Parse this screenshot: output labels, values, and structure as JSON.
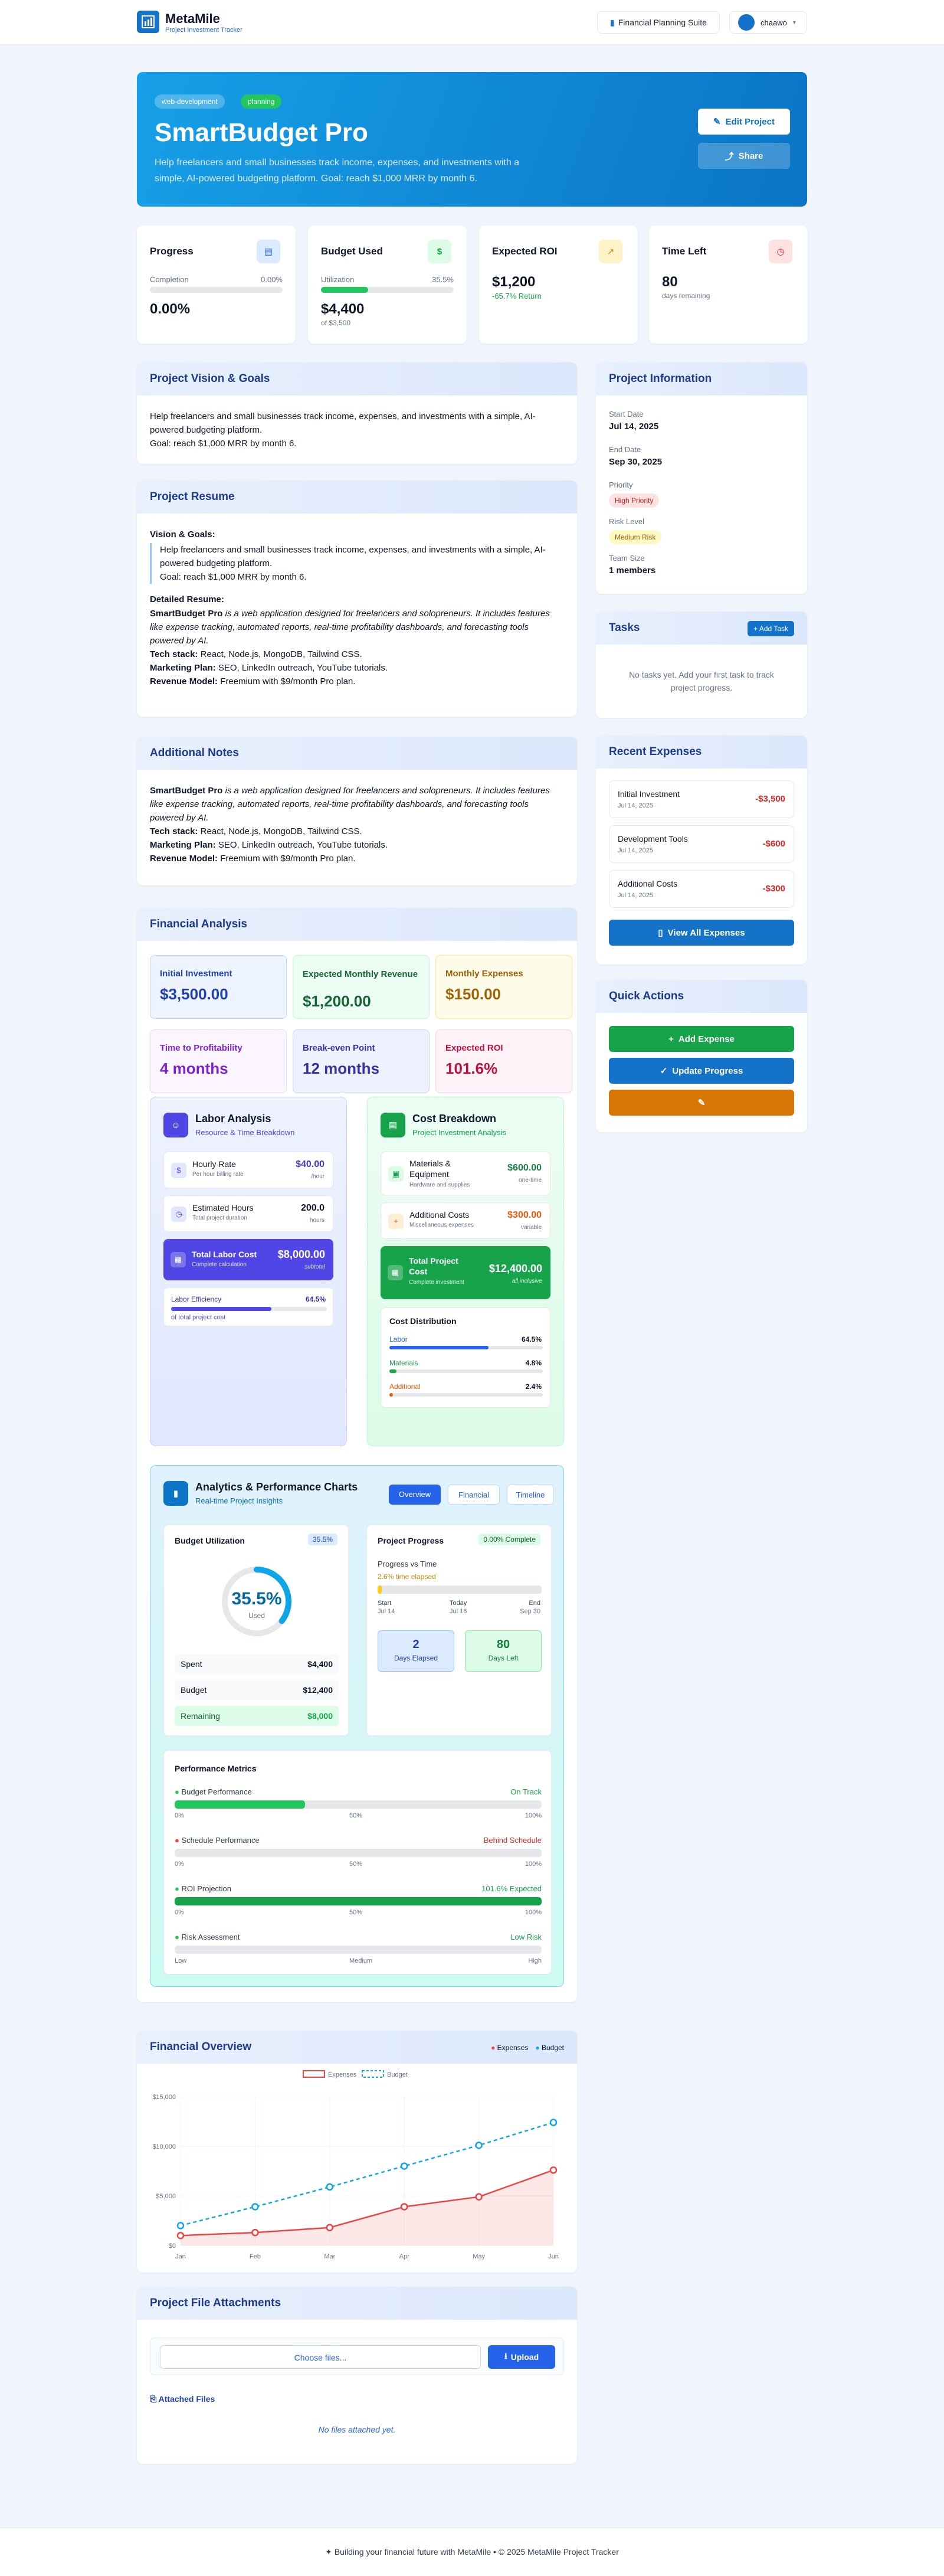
{
  "header": {
    "brand": "MetaMile",
    "subtitle": "Project Investment Tracker",
    "suite_label": "Financial Planning Suite",
    "user_name": "chaawo"
  },
  "hero": {
    "tags": [
      "web-development",
      "planning"
    ],
    "title": "SmartBudget Pro",
    "description": "Help freelancers and small businesses track income, expenses, and investments with a simple, AI-powered budgeting platform. Goal: reach $1,000 MRR by month 6.",
    "edit_label": "Edit Project",
    "share_label": "Share"
  },
  "stats": {
    "progress": {
      "title": "Progress",
      "label": "Completion",
      "pct": "0.00%",
      "value": "0.00%",
      "fill": 0
    },
    "budget": {
      "title": "Budget Used",
      "label": "Utilization",
      "pct": "35.5%",
      "value": "$4,400",
      "sub": "of $3,500",
      "fill": 0.355,
      "icon": "$"
    },
    "roi": {
      "title": "Expected ROI",
      "value": "$1,200",
      "sub": "-65.7% Return"
    },
    "time": {
      "title": "Time Left",
      "value": "80",
      "sub": "days remaining"
    }
  },
  "vision": {
    "title": "Project Vision & Goals",
    "line1": "Help freelancers and small businesses track income, expenses, and investments with a simple, AI-powered budgeting platform.",
    "line2": "Goal: reach $1,000 MRR by month 6."
  },
  "resume": {
    "title": "Project Resume",
    "vg_label": "Vision & Goals:",
    "vg_text": "Help freelancers and small businesses track income, expenses, and investments with a simple, AI-powered budgeting platform.",
    "vg_goal": "Goal: reach $1,000 MRR by month 6.",
    "detailed_label": "Detailed Resume:",
    "name": "SmartBudget Pro",
    "desc": " is a web application designed for freelancers and solopreneurs. It includes features like expense tracking, automated reports, real-time profitability dashboards, and forecasting tools powered by AI.",
    "tech_label": "Tech stack:",
    "tech": " React, Node.js, MongoDB, Tailwind CSS.",
    "mkt_label": "Marketing Plan:",
    "mkt": " SEO, LinkedIn outreach, YouTube tutorials.",
    "rev_label": "Revenue Model:",
    "rev": " Freemium with $9/month Pro plan."
  },
  "notes": {
    "title": "Additional Notes"
  },
  "info": {
    "title": "Project Information",
    "start_label": "Start Date",
    "start": "Jul 14, 2025",
    "end_label": "End Date",
    "end": "Sep 30, 2025",
    "priority_label": "Priority",
    "priority": "High Priority",
    "risk_label": "Risk Level",
    "risk": "Medium Risk",
    "team_label": "Team Size",
    "team": "1 members"
  },
  "tasks": {
    "title": "Tasks",
    "add_label": "+ Add Task",
    "empty": "No tasks yet. Add your first task to track project progress."
  },
  "expenses": {
    "title": "Recent Expenses",
    "items": [
      {
        "name": "Initial Investment",
        "date": "Jul 14, 2025",
        "amount": "-$3,500"
      },
      {
        "name": "Development Tools",
        "date": "Jul 14, 2025",
        "amount": "-$600"
      },
      {
        "name": "Additional Costs",
        "date": "Jul 14, 2025",
        "amount": "-$300"
      }
    ],
    "view_all": "View All Expenses"
  },
  "actions": {
    "title": "Quick Actions",
    "add_expense": "Add Expense",
    "update_progress": "Update Progress"
  },
  "financial": {
    "title": "Financial Analysis",
    "cards": [
      {
        "label": "Initial Investment",
        "value": "$3,500.00"
      },
      {
        "label": "Expected Monthly Revenue",
        "value": "$1,200.00"
      },
      {
        "label": "Monthly Expenses",
        "value": "$150.00"
      },
      {
        "label": "Time to Profitability",
        "value": "4 months"
      },
      {
        "label": "Break-even Point",
        "value": "12 months"
      },
      {
        "label": "Expected ROI",
        "value": "101.6%"
      }
    ]
  },
  "labor": {
    "title": "Labor Analysis",
    "subtitle": "Resource & Time Breakdown",
    "rate_label": "Hourly Rate",
    "rate_sub": "Per hour billing rate",
    "rate": "$40.00",
    "rate_unit": "/hour",
    "hours_label": "Estimated Hours",
    "hours_sub": "Total project duration",
    "hours": "200.0",
    "hours_unit": "hours",
    "total_label": "Total Labor Cost",
    "total_sub": "Complete calculation",
    "total": "$8,000.00",
    "total_unit": "subtotal",
    "eff_label": "Labor Efficiency",
    "eff": "64.5%",
    "eff_sub": "of total project cost",
    "eff_fill": 0.645
  },
  "cost": {
    "title": "Cost Breakdown",
    "subtitle": "Project Investment Analysis",
    "mat_label": "Materials & Equipment",
    "mat_sub": "Hardware and supplies",
    "mat": "$600.00",
    "mat_unit": "one-time",
    "add_label": "Additional Costs",
    "add_sub": "Miscellaneous expenses",
    "add": "$300.00",
    "add_unit": "variable",
    "total_label": "Total Project Cost",
    "total_sub": "Complete investment",
    "total": "$12,400.00",
    "total_unit": "all inclusive",
    "dist_title": "Cost Distribution",
    "dist": [
      {
        "label": "Labor",
        "pct": "64.5%",
        "fill": 0.645,
        "color": "#2563eb"
      },
      {
        "label": "Materials",
        "pct": "4.8%",
        "fill": 0.048,
        "color": "#16a34a"
      },
      {
        "label": "Additional",
        "pct": "2.4%",
        "fill": 0.024,
        "color": "#ea580c"
      }
    ]
  },
  "analytics": {
    "title": "Analytics & Performance Charts",
    "subtitle": "Real-time Project Insights",
    "tabs": [
      "Overview",
      "Financial",
      "Timeline"
    ],
    "bu_title": "Budget Utilization",
    "bu_pct": "35.5%",
    "bu_center": "35.5%",
    "bu_used": "Used",
    "bu_fill": 0.355,
    "spent_label": "Spent",
    "spent": "$4,400",
    "budget_label": "Budget",
    "budget": "$12,400",
    "remaining_label": "Remaining",
    "remaining": "$8,000",
    "pp_title": "Project Progress",
    "pp_badge": "0.00% Complete",
    "pvt": "Progress vs Time",
    "elapsed_text": "2.6% time elapsed",
    "time_fill": 0.026,
    "start": "Start",
    "start_date": "Jul 14",
    "today": "Today",
    "today_date": "Jul 16",
    "end": "End",
    "end_date": "Sep 30",
    "days_elapsed": "2",
    "days_elapsed_label": "Days Elapsed",
    "days_left": "80",
    "days_left_label": "Days Left",
    "pm_title": "Performance Metrics",
    "metrics": [
      {
        "label": "Budget Performance",
        "status": "On Track",
        "fill": 0.355,
        "dot": "#22c55e",
        "scolor": "#16a34a",
        "bar": "#22c55e",
        "ticks": [
          "0%",
          "50%",
          "100%"
        ]
      },
      {
        "label": "Schedule Performance",
        "status": "Behind Schedule",
        "fill": 0,
        "dot": "#ef4444",
        "scolor": "#dc2626",
        "bar": "#ef4444",
        "ticks": [
          "0%",
          "50%",
          "100%"
        ]
      },
      {
        "label": "ROI Projection",
        "status": "101.6% Expected",
        "fill": 1,
        "dot": "#22c55e",
        "scolor": "#16a34a",
        "bar": "#16a34a",
        "ticks": [
          "0%",
          "50%",
          "100%"
        ]
      },
      {
        "label": "Risk Assessment",
        "status": "Low Risk",
        "fill": 0,
        "dot": "#22c55e",
        "scolor": "#16a34a",
        "bar": "#22c55e",
        "ticks": [
          "Low",
          "Medium",
          "High"
        ]
      }
    ]
  },
  "overview": {
    "title": "Financial Overview",
    "legend_expenses": "Expenses",
    "legend_budget": "Budget"
  },
  "chart_data": {
    "type": "line",
    "categories": [
      "Jan",
      "Feb",
      "Mar",
      "Apr",
      "May",
      "Jun"
    ],
    "series": [
      {
        "name": "Expenses",
        "values": [
          1000,
          1300,
          1800,
          3900,
          4900,
          7600
        ],
        "color": "#ef4444"
      },
      {
        "name": "Budget",
        "values": [
          2000,
          3900,
          5900,
          8000,
          10100,
          12400
        ],
        "color": "#0ea5e9"
      }
    ],
    "ylim": [
      0,
      15000
    ],
    "yticks": [
      "$0",
      "$5,000",
      "$10,000",
      "$15,000"
    ],
    "grid": true,
    "legend": "top"
  },
  "attachments": {
    "title": "Project File Attachments",
    "choose": "Choose files...",
    "upload": "Upload",
    "attached": "Attached Files",
    "empty": "No files attached yet."
  },
  "footer": {
    "text": "Building your financial future with MetaMile • © 2025 MetaMile Project Tracker"
  }
}
